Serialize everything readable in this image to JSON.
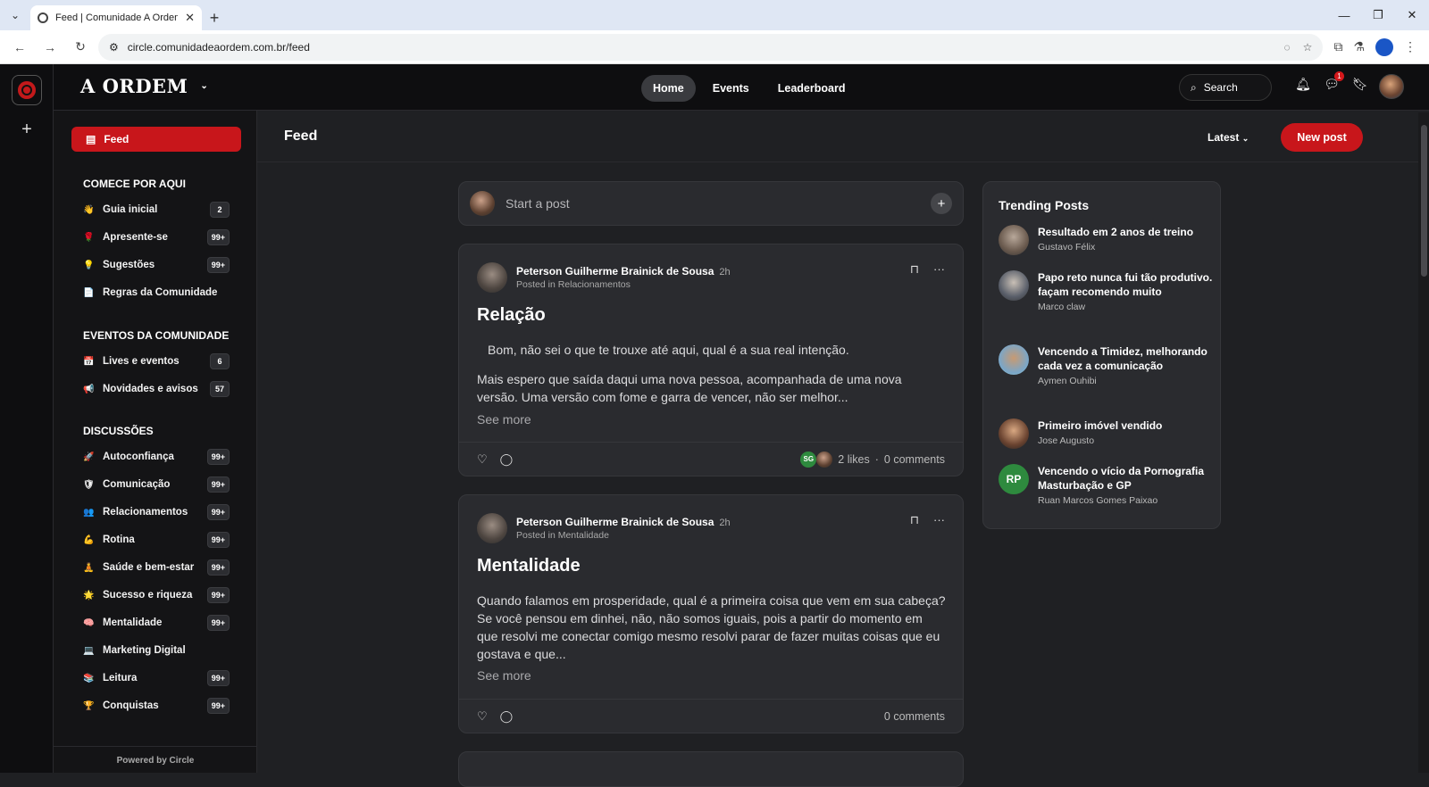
{
  "browser": {
    "tab_title": "Feed | Comunidade A Ordem",
    "url": "circle.comunidadeaordem.com.br/feed"
  },
  "header": {
    "brand": "A ORDEM",
    "nav": [
      "Home",
      "Events",
      "Leaderboard"
    ],
    "search_label": "Search",
    "notifications_badge": "1"
  },
  "sidebar": {
    "feed_label": "Feed",
    "sections": [
      {
        "title": "COMECE POR AQUI",
        "items": [
          {
            "emoji": "👋",
            "label": "Guia inicial",
            "count": "2"
          },
          {
            "emoji": "🌹",
            "label": "Apresente-se",
            "count": "99+"
          },
          {
            "emoji": "💡",
            "label": "Sugestões",
            "count": "99+"
          },
          {
            "emoji": "📄",
            "label": "Regras da Comunidade",
            "count": ""
          }
        ]
      },
      {
        "title": "EVENTOS DA COMUNIDADE",
        "items": [
          {
            "emoji": "📅",
            "label": "Lives e eventos",
            "count": "6"
          },
          {
            "emoji": "📢",
            "label": "Novidades e avisos",
            "count": "57"
          }
        ]
      },
      {
        "title": "DISCUSSÕES",
        "items": [
          {
            "emoji": "🚀",
            "label": "Autoconfiança",
            "count": "99+"
          },
          {
            "emoji": "🛡",
            "label": "Comunicação",
            "count": "99+"
          },
          {
            "emoji": "👥",
            "label": "Relacionamentos",
            "count": "99+"
          },
          {
            "emoji": "💪",
            "label": "Rotina",
            "count": "99+"
          },
          {
            "emoji": "🧘",
            "label": "Saúde e bem-estar",
            "count": "99+"
          },
          {
            "emoji": "🌟",
            "label": "Sucesso e riqueza",
            "count": "99+"
          },
          {
            "emoji": "🧠",
            "label": "Mentalidade",
            "count": "99+"
          },
          {
            "emoji": "💻",
            "label": "Marketing Digital",
            "count": ""
          },
          {
            "emoji": "📚",
            "label": "Leitura",
            "count": "99+"
          },
          {
            "emoji": "🏆",
            "label": "Conquistas",
            "count": "99+"
          }
        ]
      }
    ],
    "powered": "Powered by Circle"
  },
  "main": {
    "title": "Feed",
    "sort_label": "Latest",
    "new_post_label": "New post",
    "composer_placeholder": "Start a post",
    "posts": [
      {
        "author": "Peterson Guilherme Brainick de Sousa",
        "time": "2h",
        "posted_in": "Posted in Relacionamentos",
        "title": "Relação",
        "body1": "Bom, não sei o que te trouxe até aqui, qual é a sua real intenção.",
        "body2": "Mais espero que saída daqui uma nova pessoa, acompanhada de uma nova versão. Uma versão com fome e garra de vencer, não ser melhor...",
        "see_more": "See more",
        "liker_initials": "SG",
        "likes": "2 likes",
        "comments": "0 comments"
      },
      {
        "author": "Peterson Guilherme Brainick de Sousa",
        "time": "2h",
        "posted_in": "Posted in Mentalidade",
        "title": "Mentalidade",
        "body1": "Quando falamos em prosperidade, qual é a primeira coisa que vem em sua cabeça? Se você pensou em dinhei, não, não somos iguais, pois a partir do momento em que resolvi me conectar comigo mesmo resolvi parar de fazer muitas coisas que eu gostava e que...",
        "see_more": "See more",
        "comments": "0 comments"
      }
    ]
  },
  "trending": {
    "title": "Trending Posts",
    "posts": [
      {
        "title": "Resultado em 2 anos de treino",
        "author": "Gustavo Félix"
      },
      {
        "title": "Papo reto nunca fui tão produtivo. façam recomendo muito",
        "author": "Marco claw"
      },
      {
        "title": "Vencendo a Timidez, melhorando cada vez a comunicação",
        "author": "Aymen Ouhibi"
      },
      {
        "title": "Primeiro imóvel vendido",
        "author": "Jose Augusto"
      },
      {
        "title": "Vencendo o vício da Pornografia Masturbação e GP",
        "author": "Ruan Marcos Gomes Paixao",
        "initials": "RP"
      }
    ]
  }
}
